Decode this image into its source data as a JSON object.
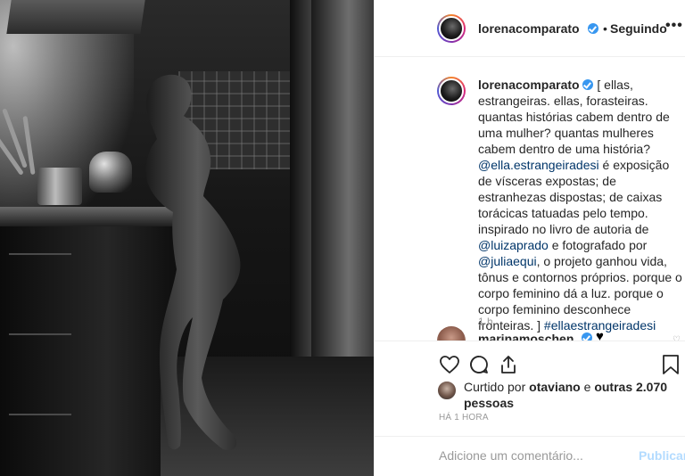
{
  "post": {
    "author": {
      "username": "lorenacomparato",
      "verified": true,
      "follow_separator": "•",
      "follow_status": "Seguindo"
    },
    "more_options_label": "•••",
    "caption": {
      "username": "lorenacomparato",
      "part1": " [ ellas, estrangeiras. ellas, forasteiras. quantas histórias cabem dentro de uma mulher? quantas mulheres cabem dentro de uma história? ",
      "mention1": "@ella.estrangeiradesi",
      "part2": " é exposição de vísceras expostas; de estranhezas dispostas; de caixas torácicas tatuadas pelo tempo. inspirado no livro de autoria de ",
      "mention2": "@luizaprado",
      "part3": " e fotografado por ",
      "mention3": "@juliaequi",
      "part4": ", o projeto ganhou vida, tônus e contornos próprios. porque o corpo feminino dá a luz. porque o corpo feminino desconhece fronteiras. ] ",
      "hashtag": "#ellaestrangeiradesi",
      "time": "1 h"
    },
    "comments": [
      {
        "username": "marinamoschen",
        "verified": true,
        "text": "♥"
      }
    ],
    "actions": {
      "like_icon": "heart-icon",
      "comment_icon": "comment-icon",
      "share_icon": "share-icon",
      "save_icon": "bookmark-icon"
    },
    "likes": {
      "prefix": "Curtido por ",
      "user": "otaviano",
      "middle": " e ",
      "others": "outras 2.070 pessoas"
    },
    "timestamp": "HÁ 1 HORA",
    "add_comment": {
      "placeholder": "Adicione um comentário...",
      "publish_label": "Publicar"
    }
  },
  "colors": {
    "link": "#003569",
    "verified": "#3897f0",
    "publish_disabled": "#b3dbff",
    "muted": "#999999"
  }
}
